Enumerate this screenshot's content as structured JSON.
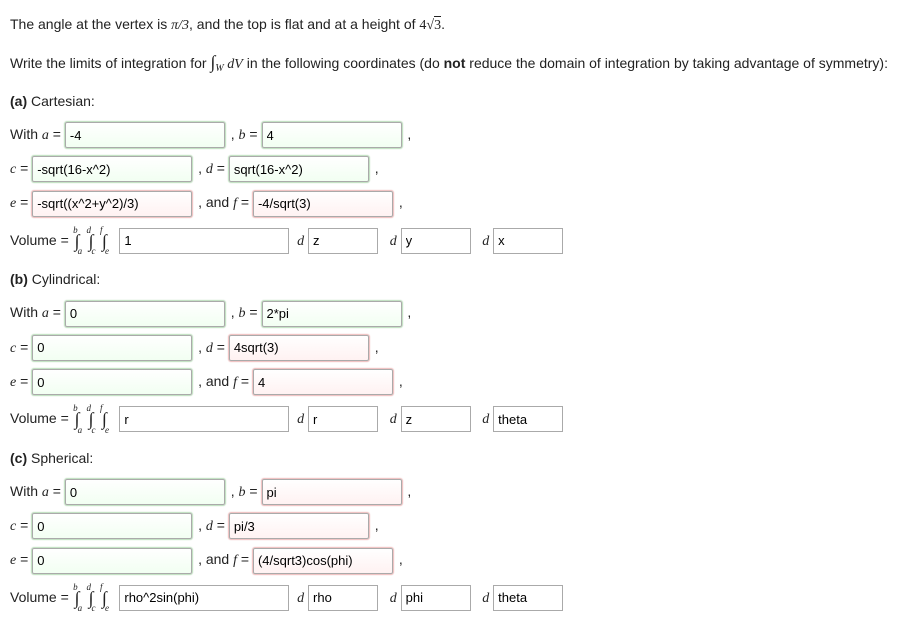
{
  "intro": {
    "line1_pre": "The angle at the vertex is ",
    "line1_mid": ", and the top is flat and at a height of ",
    "line1_post": ".",
    "pi_over_3_num": "π",
    "pi_over_3_den": "3",
    "height_coef": "4",
    "height_rad": "3",
    "line2_pre": "Write the limits of integration for ",
    "integral_sub": "W",
    "integral_dv": "dV",
    "line2_post": " in the following coordinates (do ",
    "not": "not",
    "line2_post2": " reduce the domain of integration by taking advantage of symmetry):"
  },
  "parts": {
    "a": {
      "title_label": "(a)",
      "title_text": "Cartesian:",
      "a_val": "-4",
      "b_val": "4",
      "c_val": "-sqrt(16-x^2)",
      "d_val": "sqrt(16-x^2)",
      "e_val": "-sqrt((x^2+y^2)/3)",
      "f_val": "-4/sqrt(3)",
      "integrand": "1",
      "d1": "z",
      "d2": "y",
      "d3": "x",
      "a_state": "green",
      "b_state": "green",
      "c_state": "green",
      "d_state": "green",
      "e_state": "red",
      "f_state": "red"
    },
    "b": {
      "title_label": "(b)",
      "title_text": "Cylindrical:",
      "a_val": "0",
      "b_val": "2*pi",
      "c_val": "0",
      "d_val": "4sqrt(3)",
      "e_val": "0",
      "f_val": "4",
      "integrand": "r",
      "d1": "r",
      "d2": "z",
      "d3": "theta",
      "a_state": "green",
      "b_state": "green",
      "c_state": "green",
      "d_state": "red",
      "e_state": "green",
      "f_state": "red"
    },
    "c": {
      "title_label": "(c)",
      "title_text": "Spherical:",
      "a_val": "0",
      "b_val": "pi",
      "c_val": "0",
      "d_val": "pi/3",
      "e_val": "0",
      "f_val": "(4/sqrt3)cos(phi)",
      "integrand": "rho^2sin(phi)",
      "d1": "rho",
      "d2": "phi",
      "d3": "theta",
      "a_state": "green",
      "b_state": "red",
      "c_state": "green",
      "d_state": "red",
      "e_state": "green",
      "f_state": "red"
    }
  },
  "labels": {
    "with_a": "With ",
    "a_eq": "a",
    "b_eq": "b",
    "c_eq": "c",
    "d_eq": "d",
    "e_eq": "e",
    "f_eq": "f",
    "and": "and",
    "volume": "Volume = ",
    "d_letter": "d",
    "eq": " = "
  }
}
